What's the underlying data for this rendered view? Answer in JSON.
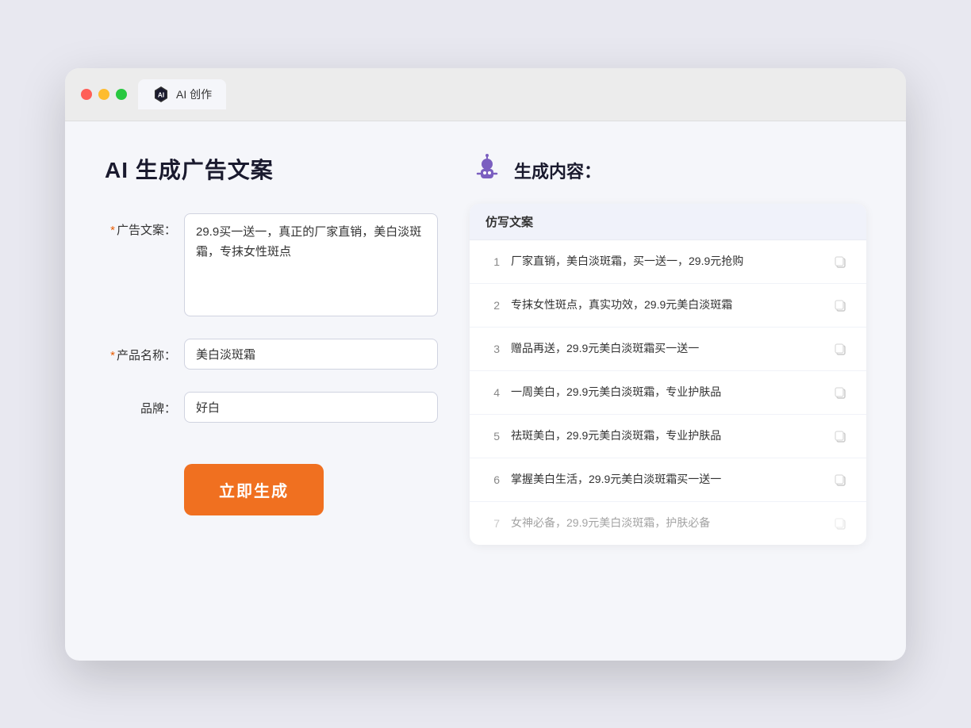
{
  "browser": {
    "tab_label": "AI 创作"
  },
  "page": {
    "title": "AI 生成广告文案"
  },
  "form": {
    "ad_copy_label": "广告文案：",
    "ad_copy_required": "*",
    "ad_copy_value": "29.9买一送一，真正的厂家直销，美白淡斑霜，专抹女性斑点",
    "product_name_label": "产品名称：",
    "product_name_required": "*",
    "product_name_value": "美白淡斑霜",
    "brand_label": "品牌：",
    "brand_value": "好白",
    "generate_btn": "立即生成"
  },
  "result": {
    "title": "生成内容：",
    "table_header": "仿写文案",
    "items": [
      {
        "num": "1",
        "text": "厂家直销，美白淡斑霜，买一送一，29.9元抢购",
        "dimmed": false
      },
      {
        "num": "2",
        "text": "专抹女性斑点，真实功效，29.9元美白淡斑霜",
        "dimmed": false
      },
      {
        "num": "3",
        "text": "赠品再送，29.9元美白淡斑霜买一送一",
        "dimmed": false
      },
      {
        "num": "4",
        "text": "一周美白，29.9元美白淡斑霜，专业护肤品",
        "dimmed": false
      },
      {
        "num": "5",
        "text": "祛斑美白，29.9元美白淡斑霜，专业护肤品",
        "dimmed": false
      },
      {
        "num": "6",
        "text": "掌握美白生活，29.9元美白淡斑霜买一送一",
        "dimmed": false
      },
      {
        "num": "7",
        "text": "女神必备，29.9元美白淡斑霜，护肤必备",
        "dimmed": true
      }
    ]
  },
  "colors": {
    "accent_orange": "#f07020",
    "required_red": "#e85d04",
    "robot_purple": "#7b5fc0"
  }
}
